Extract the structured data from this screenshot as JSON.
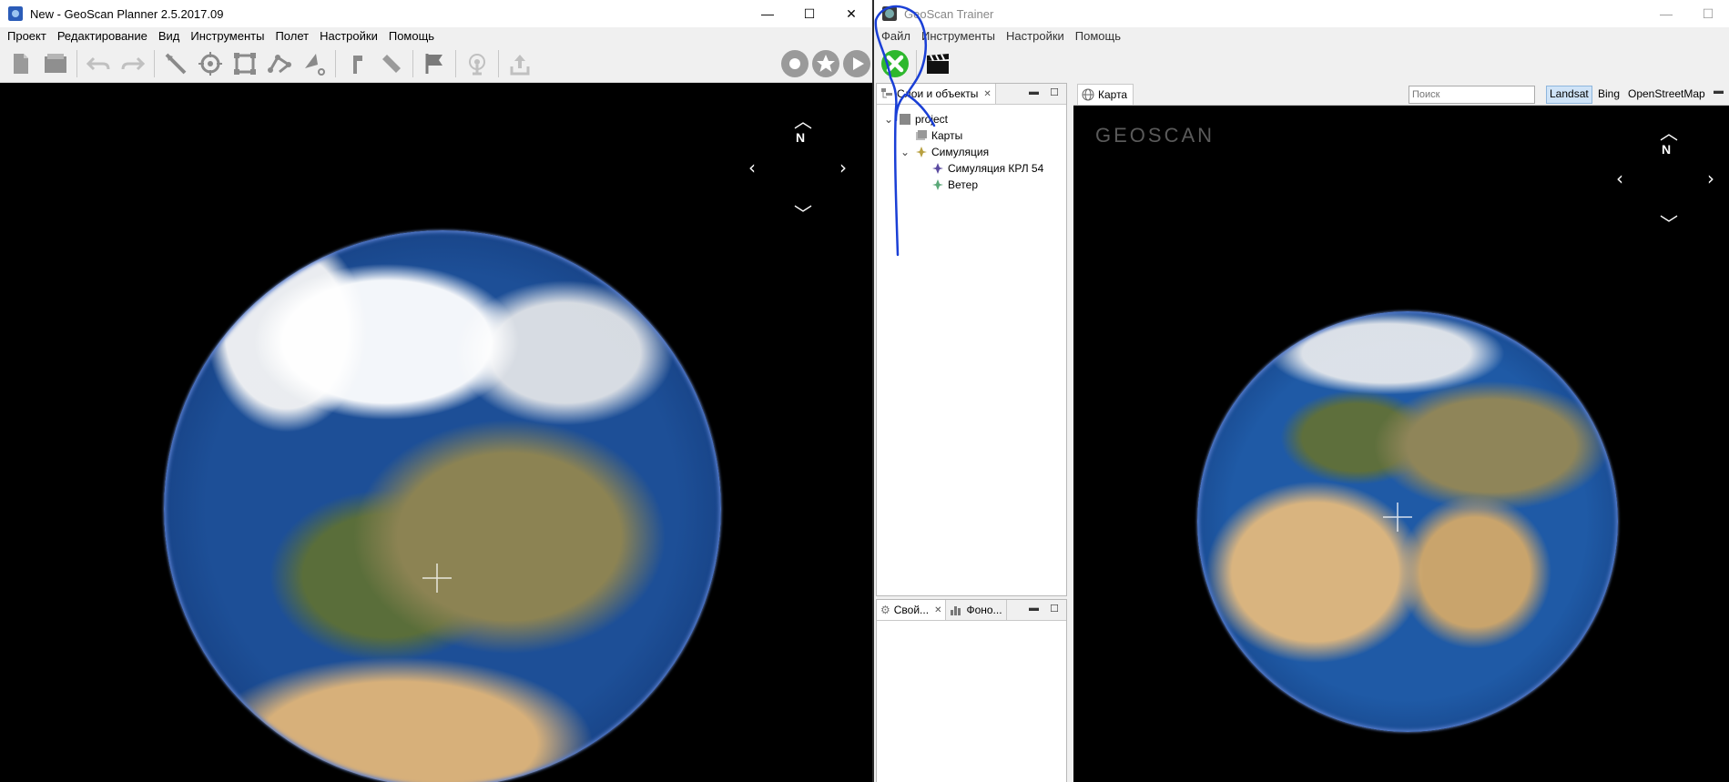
{
  "left_window": {
    "title": "New - GeoScan Planner 2.5.2017.09",
    "controls": {
      "minimize": "—",
      "maximize": "☐",
      "close": "✕"
    },
    "menu": [
      "Проект",
      "Редактирование",
      "Вид",
      "Инструменты",
      "Полет",
      "Настройки",
      "Помощь"
    ],
    "toolbar_icons": [
      "new-file-icon",
      "open-icon",
      "undo-icon",
      "redo-icon",
      "line-tool-icon",
      "point-tool-icon",
      "polygon-tool-icon",
      "route-tool-icon",
      "pointer-tool-icon",
      "ruler-icon",
      "measure-icon",
      "flag-icon",
      "antenna-icon",
      "upload-icon",
      "record-icon",
      "star-icon",
      "play-icon"
    ],
    "map": {
      "north_label": "N"
    }
  },
  "right_window": {
    "title": "GeoScan Trainer",
    "controls": {
      "minimize": "—",
      "maximize": "☐"
    },
    "menu": [
      "Файл",
      "Инструменты",
      "Настройки",
      "Помощь"
    ],
    "layers_panel": {
      "tab_label": "Слои и объекты",
      "tree": [
        {
          "label": "project",
          "level": 0,
          "expander": "⌄",
          "icon": "project-icon"
        },
        {
          "label": "Карты",
          "level": 1,
          "expander": "",
          "icon": "maps-icon"
        },
        {
          "label": "Симуляция",
          "level": 1,
          "expander": "⌄",
          "icon": "simulation-icon"
        },
        {
          "label": "Симуляция КРЛ 54",
          "level": 2,
          "expander": "",
          "icon": "drone-icon"
        },
        {
          "label": "Ветер",
          "level": 2,
          "expander": "",
          "icon": "wind-icon"
        }
      ]
    },
    "props_panel": {
      "tab1_label": "Свой...",
      "tab2_label": "Фоно..."
    },
    "map": {
      "tab_label": "Карта",
      "search_placeholder": "Поиск",
      "layers": [
        "Landsat",
        "Bing",
        "OpenStreetMap"
      ],
      "active_layer": "Landsat",
      "logo": "GEOSCAN",
      "north_label": "N"
    }
  },
  "colors": {
    "annotation_pen": "#1a3fd6",
    "stop_button": "#2eb82e",
    "logo_accent": "#e8412c"
  }
}
